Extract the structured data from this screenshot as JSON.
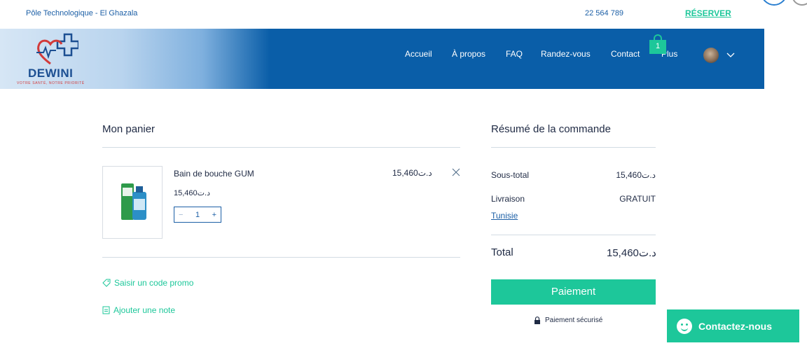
{
  "topbar": {
    "address": "Pôle Technologique - El Ghazala",
    "phone": "22 564 789",
    "reserve_label": "RÉSERVER"
  },
  "brand": {
    "name": "DEWINI",
    "tagline": "VOTRE SANTÉ, NOTRE PRIORITÉ"
  },
  "nav": {
    "items": [
      "Accueil",
      "À propos",
      "FAQ",
      "Randez-vous",
      "Contact",
      "Plus"
    ],
    "cart_count": "1"
  },
  "cart": {
    "title": "Mon panier",
    "item": {
      "name": "Bain de bouche GUM",
      "unit_price": "15,460د.ت",
      "quantity": "1",
      "line_total": "15,460د.ت"
    },
    "promo_label": "Saisir un code promo",
    "note_label": "Ajouter une note"
  },
  "summary": {
    "title": "Résumé de la commande",
    "subtotal_label": "Sous-total",
    "subtotal_value": "15,460د.ت",
    "shipping_label": "Livraison",
    "shipping_value": "GRATUIT",
    "country": "Tunisie",
    "total_label": "Total",
    "total_value": "15,460د.ت",
    "pay_label": "Paiement",
    "secure_label": "Paiement sécurisé"
  },
  "chat": {
    "label": "Contactez-nous"
  },
  "colors": {
    "nav_blue": "#0a5ea8",
    "accent_green": "#1dc79a",
    "link_blue": "#1c5fa6"
  }
}
